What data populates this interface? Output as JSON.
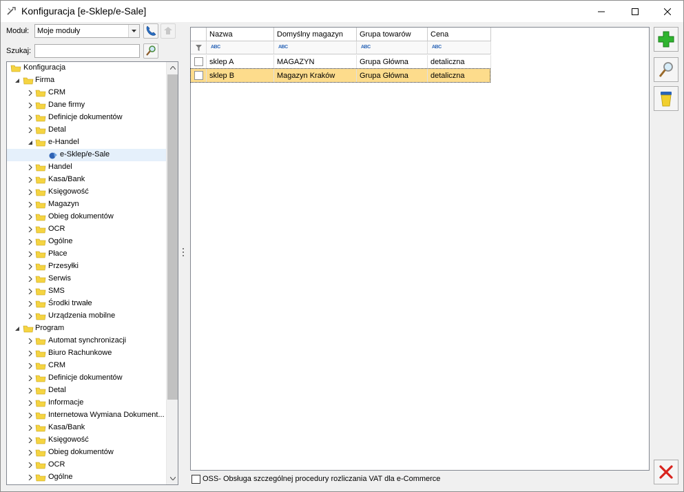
{
  "window": {
    "title": "Konfiguracja [e-Sklep/e-Sale]"
  },
  "module": {
    "label": "Moduł:",
    "value": "Moje moduły"
  },
  "search": {
    "label": "Szukaj:",
    "value": ""
  },
  "tree": [
    {
      "label": "Konfiguracja",
      "level": 0,
      "expander": "none"
    },
    {
      "label": "Firma",
      "level": 1,
      "expander": "open"
    },
    {
      "label": "CRM",
      "level": 2,
      "expander": "closed"
    },
    {
      "label": "Dane firmy",
      "level": 2,
      "expander": "closed"
    },
    {
      "label": "Definicje dokumentów",
      "level": 2,
      "expander": "closed"
    },
    {
      "label": "Detal",
      "level": 2,
      "expander": "closed"
    },
    {
      "label": "e-Handel",
      "level": 2,
      "expander": "open"
    },
    {
      "label": "e-Sklep/e-Sale",
      "level": 3,
      "expander": "none",
      "selected": true
    },
    {
      "label": "Handel",
      "level": 2,
      "expander": "closed"
    },
    {
      "label": "Kasa/Bank",
      "level": 2,
      "expander": "closed"
    },
    {
      "label": "Księgowość",
      "level": 2,
      "expander": "closed"
    },
    {
      "label": "Magazyn",
      "level": 2,
      "expander": "closed"
    },
    {
      "label": "Obieg dokumentów",
      "level": 2,
      "expander": "closed"
    },
    {
      "label": "OCR",
      "level": 2,
      "expander": "closed"
    },
    {
      "label": "Ogólne",
      "level": 2,
      "expander": "closed"
    },
    {
      "label": "Płace",
      "level": 2,
      "expander": "closed"
    },
    {
      "label": "Przesyłki",
      "level": 2,
      "expander": "closed"
    },
    {
      "label": "Serwis",
      "level": 2,
      "expander": "closed"
    },
    {
      "label": "SMS",
      "level": 2,
      "expander": "closed"
    },
    {
      "label": "Środki trwałe",
      "level": 2,
      "expander": "closed"
    },
    {
      "label": "Urządzenia mobilne",
      "level": 2,
      "expander": "closed"
    },
    {
      "label": "Program",
      "level": 1,
      "expander": "open"
    },
    {
      "label": "Automat synchronizacji",
      "level": 2,
      "expander": "closed"
    },
    {
      "label": "Biuro Rachunkowe",
      "level": 2,
      "expander": "closed"
    },
    {
      "label": "CRM",
      "level": 2,
      "expander": "closed"
    },
    {
      "label": "Definicje dokumentów",
      "level": 2,
      "expander": "closed"
    },
    {
      "label": "Detal",
      "level": 2,
      "expander": "closed"
    },
    {
      "label": "Informacje",
      "level": 2,
      "expander": "closed"
    },
    {
      "label": "Internetowa Wymiana Dokument...",
      "level": 2,
      "expander": "closed"
    },
    {
      "label": "Kasa/Bank",
      "level": 2,
      "expander": "closed"
    },
    {
      "label": "Księgowość",
      "level": 2,
      "expander": "closed"
    },
    {
      "label": "Obieg dokumentów",
      "level": 2,
      "expander": "closed"
    },
    {
      "label": "OCR",
      "level": 2,
      "expander": "closed"
    },
    {
      "label": "Ogólne",
      "level": 2,
      "expander": "closed"
    }
  ],
  "grid": {
    "columns": [
      "Nazwa",
      "Domyślny magazyn",
      "Grupa towarów",
      "Cena"
    ],
    "rows": [
      {
        "cells": [
          "sklep A",
          "MAGAZYN",
          "Grupa Główna",
          "detaliczna"
        ],
        "selected": false
      },
      {
        "cells": [
          "sklep B",
          "Magazyn Kraków",
          "Grupa Główna",
          "detaliczna"
        ],
        "selected": true
      }
    ]
  },
  "oss": {
    "label": "OSS- Obsługa szczególnej procedury rozliczania VAT dla e-Commerce",
    "checked": false
  },
  "colors": {
    "selectedRow": "#fddc8c",
    "treeSelected": "#e5f0fb",
    "folder": "#f5d442",
    "addGreen": "#2fb52f",
    "closeRed": "#d9241e"
  }
}
